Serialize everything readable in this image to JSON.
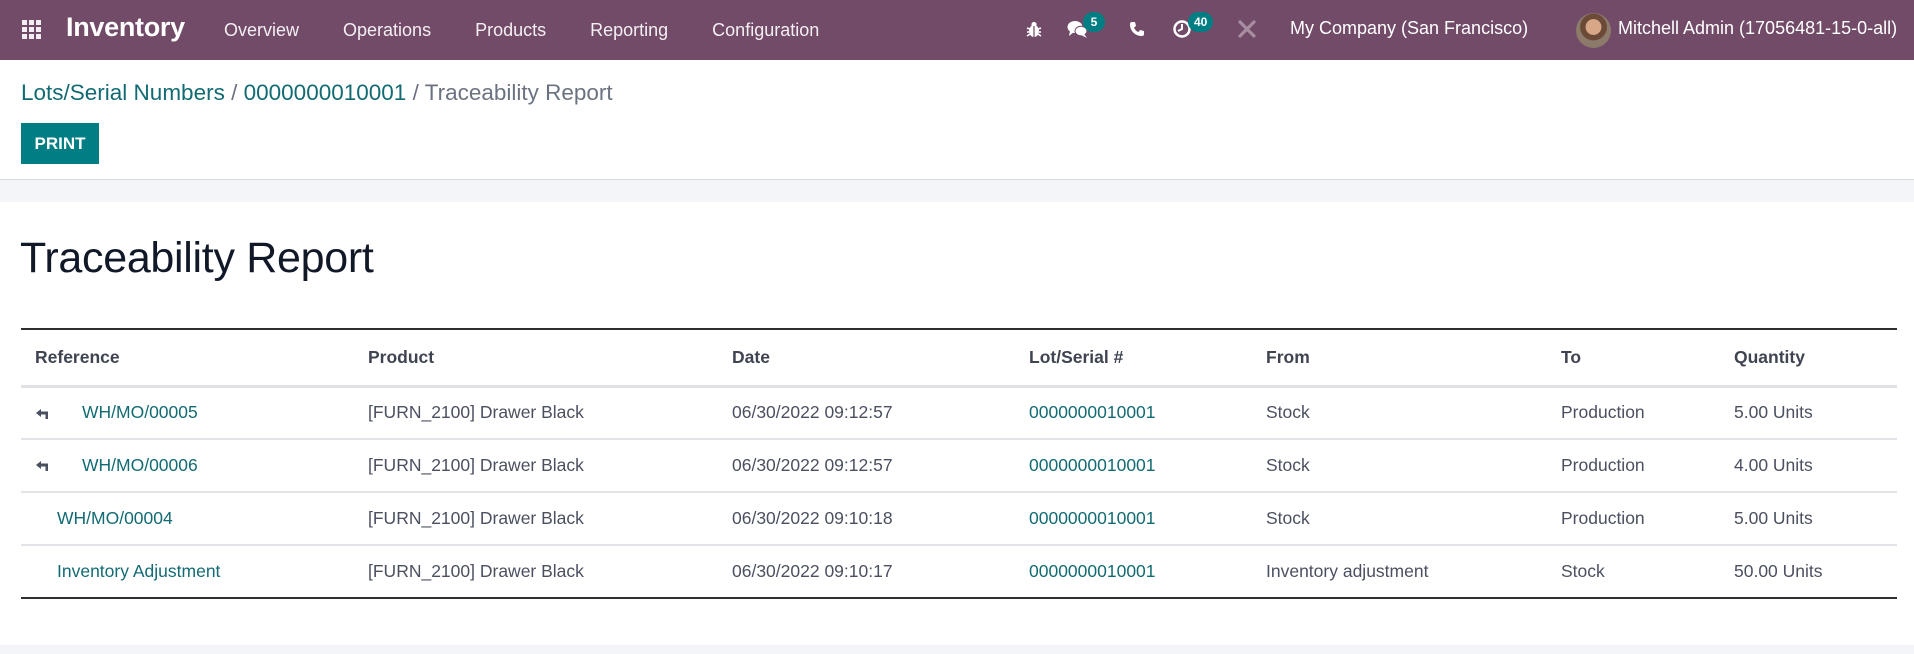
{
  "navbar": {
    "app_name": "Inventory",
    "menu": [
      {
        "label": "Overview"
      },
      {
        "label": "Operations"
      },
      {
        "label": "Products"
      },
      {
        "label": "Reporting"
      },
      {
        "label": "Configuration"
      }
    ],
    "systray": {
      "debug_icon": "bug-icon",
      "messages_icon": "chat-icon",
      "messages_count": "5",
      "phone_icon": "phone-icon",
      "activities_icon": "clock-icon",
      "activities_count": "40",
      "settings_icon": "tools-icon",
      "company": "My Company (San Francisco)",
      "user": "Mitchell Admin (17056481-15-0-all)"
    },
    "color": "#714b67"
  },
  "breadcrumb": {
    "items": [
      {
        "label": "Lots/Serial Numbers"
      },
      {
        "label": "0000000010001"
      }
    ],
    "separator": "/",
    "current": "Traceability Report"
  },
  "control_panel": {
    "print_label": "PRINT",
    "accent_color": "#017e84"
  },
  "report": {
    "title": "Traceability Report",
    "columns": [
      "Reference",
      "Product",
      "Date",
      "Lot/Serial #",
      "From",
      "To",
      "Quantity"
    ],
    "rows": [
      {
        "unfoldable": true,
        "reference": "WH/MO/00005",
        "product": "[FURN_2100] Drawer Black",
        "date": "06/30/2022 09:12:57",
        "lot": "0000000010001",
        "from": "Stock",
        "to": "Production",
        "quantity": "5.00 Units"
      },
      {
        "unfoldable": true,
        "reference": "WH/MO/00006",
        "product": "[FURN_2100] Drawer Black",
        "date": "06/30/2022 09:12:57",
        "lot": "0000000010001",
        "from": "Stock",
        "to": "Production",
        "quantity": "4.00 Units"
      },
      {
        "unfoldable": false,
        "reference": "WH/MO/00004",
        "product": "[FURN_2100] Drawer Black",
        "date": "06/30/2022 09:10:18",
        "lot": "0000000010001",
        "from": "Stock",
        "to": "Production",
        "quantity": "5.00 Units"
      },
      {
        "unfoldable": false,
        "reference": "Inventory Adjustment",
        "product": "[FURN_2100] Drawer Black",
        "date": "06/30/2022 09:10:17",
        "lot": "0000000010001",
        "from": "Inventory adjustment",
        "to": "Stock",
        "quantity": "50.00 Units"
      }
    ]
  }
}
